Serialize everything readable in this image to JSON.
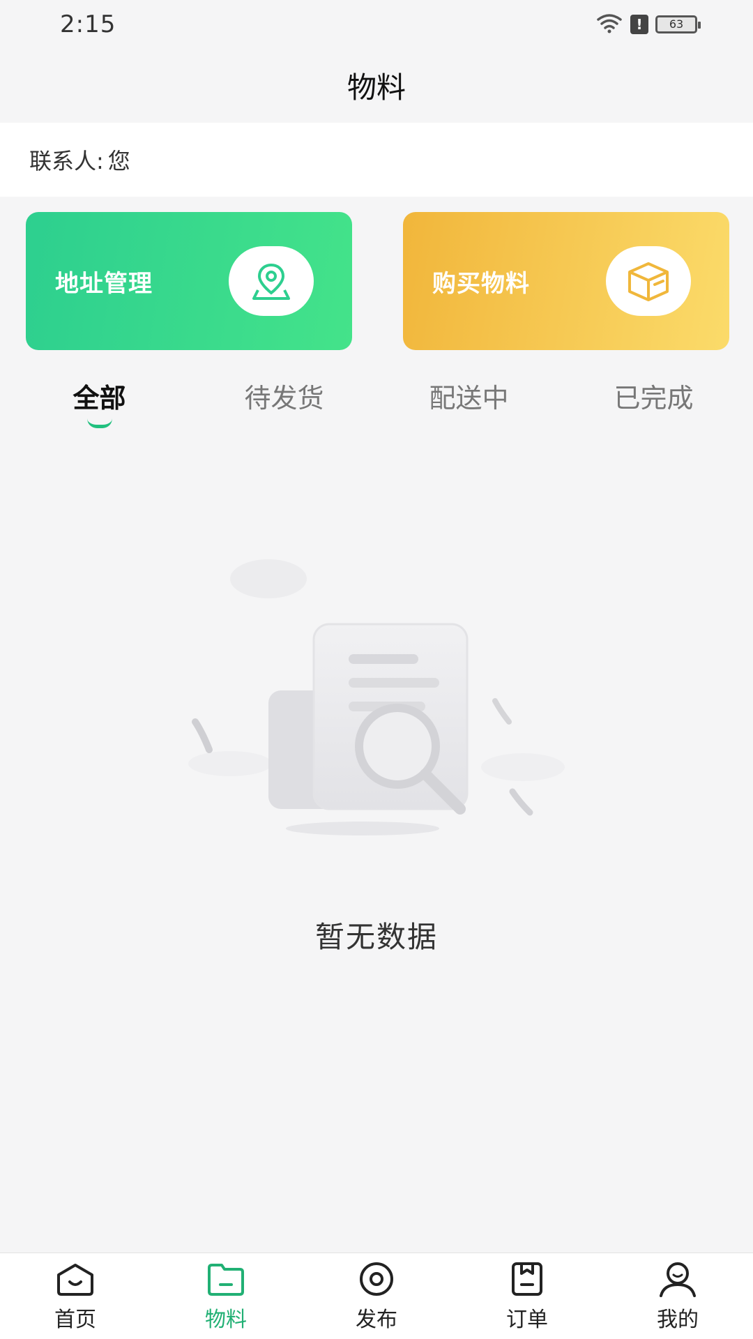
{
  "status_bar": {
    "time": "2:15",
    "battery": "63",
    "alert": "!"
  },
  "header": {
    "title": "物料"
  },
  "contact": {
    "label": "联系人:",
    "value": "您"
  },
  "cards": {
    "address": {
      "label": "地址管理",
      "icon": "location-pin-icon",
      "color": "#2dcf8f"
    },
    "buy": {
      "label": "购买物料",
      "icon": "box-icon",
      "color": "#f1b63b"
    }
  },
  "tabs": [
    {
      "label": "全部",
      "active": true
    },
    {
      "label": "待发货",
      "active": false
    },
    {
      "label": "配送中",
      "active": false
    },
    {
      "label": "已完成",
      "active": false
    }
  ],
  "empty_state": {
    "text": "暂无数据",
    "icon": "empty-document-search-icon"
  },
  "bottom_nav": [
    {
      "label": "首页",
      "icon": "home-icon",
      "active": false
    },
    {
      "label": "物料",
      "icon": "folder-icon",
      "active": true
    },
    {
      "label": "发布",
      "icon": "eye-icon",
      "active": false
    },
    {
      "label": "订单",
      "icon": "order-icon",
      "active": false
    },
    {
      "label": "我的",
      "icon": "user-icon",
      "active": false
    }
  ],
  "accent_color": "#21b074"
}
